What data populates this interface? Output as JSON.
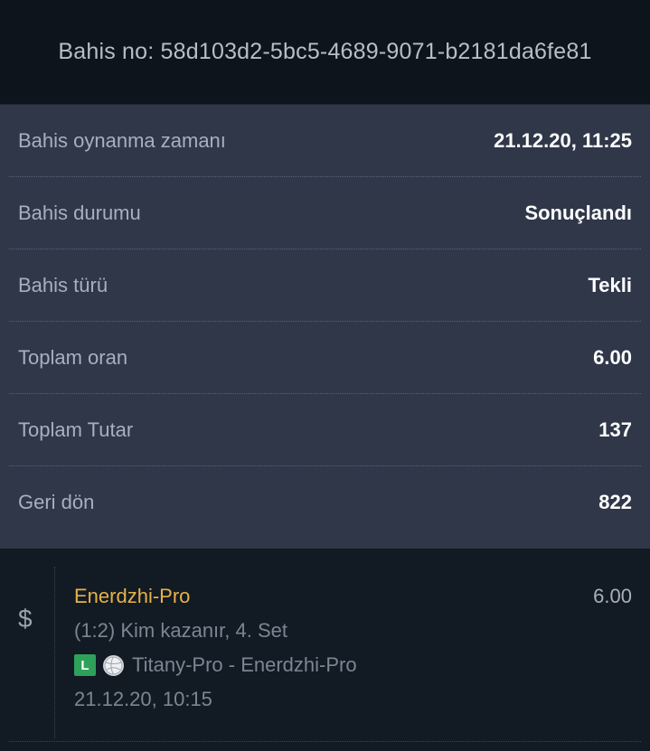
{
  "header": {
    "title": "Bahis no: 58d103d2-5bc5-4689-9071-b2181da6fe81"
  },
  "details": [
    {
      "label": "Bahis oynanma zamanı",
      "value": "21.12.20, 11:25"
    },
    {
      "label": "Bahis durumu",
      "value": "Sonuçlandı"
    },
    {
      "label": "Bahis türü",
      "value": "Tekli"
    },
    {
      "label": "Toplam oran",
      "value": "6.00"
    },
    {
      "label": "Toplam Tutar",
      "value": "137"
    },
    {
      "label": "Geri dön",
      "value": "822"
    }
  ],
  "bet": {
    "currency_symbol": "$",
    "selection": "Enerdzhi-Pro",
    "odds": "6.00",
    "market": "(1:2) Kim kazanır, 4. Set",
    "live_badge": "L",
    "sport_icon": "volleyball-icon",
    "match": "Titany-Pro - Enerdzhi-Pro",
    "date": "21.12.20, 10:15"
  },
  "colors": {
    "header_bg": "#0d141c",
    "details_bg": "#2f3749",
    "selection": "#e6b24a",
    "live_badge": "#2fa05c"
  }
}
